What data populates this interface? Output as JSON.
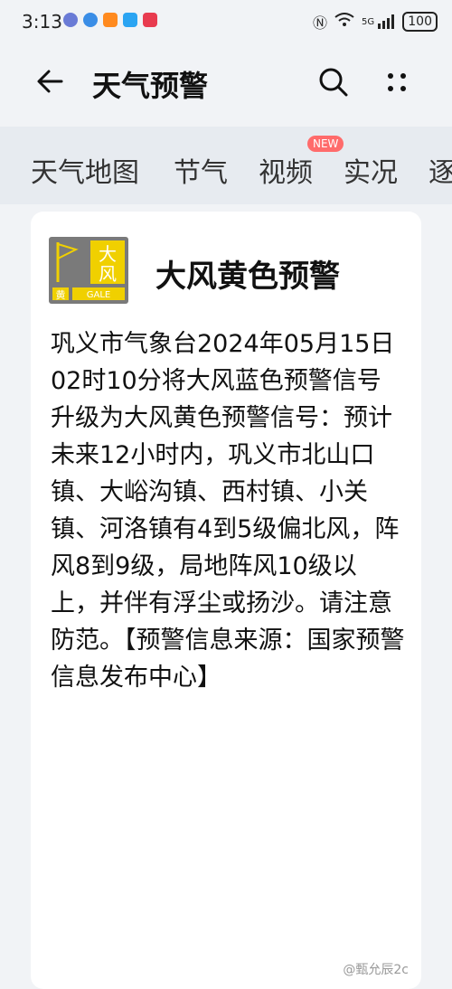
{
  "status_bar": {
    "time": "3:13",
    "network": "5G",
    "battery": "100"
  },
  "header": {
    "title": "天气预警"
  },
  "tabs": [
    {
      "label": "天气地图"
    },
    {
      "label": "节气"
    },
    {
      "label": "视频",
      "badge": "NEW"
    },
    {
      "label": "实况"
    },
    {
      "label": "逐"
    }
  ],
  "warning": {
    "title": "大风黄色预警",
    "icon_text_top": "大",
    "icon_text_mid": "风",
    "icon_text_bottom_left": "黄",
    "icon_text_bottom_right": "GALE",
    "body": "巩义市气象台2024年05月15日02时10分将大风蓝色预警信号升级为大风黄色预警信号：预计未来12小时内，巩义市北山口镇、大峪沟镇、西村镇、小关镇、河洛镇有4到5级偏北风，阵风8到9级，局地阵风10级以上，并伴有浮尘或扬沙。请注意防范。【预警信息来源：国家预警信息发布中心】"
  },
  "watermark": "@甄允辰2c",
  "colors": {
    "background": "#f1f3f6",
    "tabs_bg": "#e7ebf0",
    "warning_yellow": "#f0d000",
    "new_badge": "#ff6b6b"
  }
}
